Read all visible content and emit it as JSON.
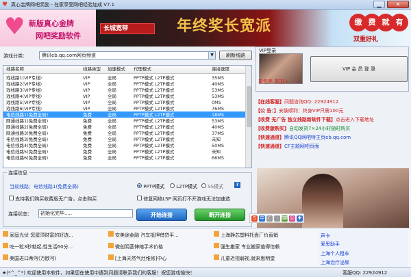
{
  "window": {
    "title": "真心金牌网吧奖励 - 在家享受网吧经验加成 V7.1",
    "minimize": "▁",
    "maximize": "□",
    "close": "✕"
  },
  "banner": {
    "left_line1": "新版真心金牌",
    "left_line2": "网吧奖励软件",
    "isp_logo": "长城宽带",
    "slogan": "年终奖长宽派",
    "promo_circles": [
      "缴",
      "费",
      "就",
      "有"
    ],
    "promo_sub": "双重好礼"
  },
  "game_category": {
    "label": "游戏分类：",
    "selected": "腾讯eb.qq.com网页频道",
    "refresh_button": "刷新线路"
  },
  "table": {
    "headers": [
      "线路名称",
      "线路类型",
      "加速模式",
      "代理模式",
      "连接速度"
    ],
    "rows": [
      [
        "戏线路1(VIP专线)",
        "VIP",
        "全局",
        "PPTP模式 L2TP模式",
        "35MS"
      ],
      [
        "戏线路2(VIP专线)",
        "VIP",
        "全局",
        "PPTP模式 L2TP模式",
        "40MS"
      ],
      [
        "戏线路3(VIP专线)",
        "VIP",
        "全局",
        "PPTP模式 L2TP模式",
        "53MS"
      ],
      [
        "戏线路4(VIP专线)",
        "VIP",
        "全局",
        "PPTP模式 L2TP模式",
        "53MS"
      ],
      [
        "戏线路5(VIP专线)",
        "VIP",
        "全局",
        "PPTP模式 L2TP模式",
        "0MS"
      ],
      [
        "戏线路6(VIP专线)",
        "VIP",
        "全局",
        "PPTP模式 L2TP模式",
        "76MS"
      ],
      [
        "电信线路1(免费全局)",
        "免费",
        "全局",
        "PPTP模式 L2TP模式",
        "18MS"
      ],
      [
        "网通线路1(免费全局)",
        "免费",
        "全局",
        "PPTP模式 L2TP模式",
        "53MS"
      ],
      [
        "网通线路2(免费全局)",
        "免费",
        "全局",
        "PPTP模式 L2TP模式",
        "40MS"
      ],
      [
        "网通线路3(免费全局)",
        "免费",
        "全局",
        "PPTP模式 L2TP模式",
        "37MS"
      ],
      [
        "电信线路3(免费全局)",
        "免费",
        "全局",
        "PPTP模式 L2TP模式",
        "未知"
      ],
      [
        "电信线路4(免费全局)",
        "免费",
        "全局",
        "PPTP模式 L2TP模式",
        "50MS"
      ],
      [
        "电信线路5(免费全局)",
        "免费",
        "全局",
        "PPTP模式 L2TP模式",
        "未知"
      ],
      [
        "电信线路6(免费全局)",
        "免费",
        "全局",
        "PPTP模式 L2TP模式",
        "66MS"
      ]
    ],
    "selected_row": 6
  },
  "connection": {
    "group_title": "连接信息",
    "current_label": "当前线路：",
    "current_value": "电信线路1(免费全局)",
    "mode_pptp": "PPTP模式",
    "mode_l2tp": "L2TP模式",
    "mode_ss": "SS模式",
    "help": "?",
    "support_checkbox": "支持我们购买收费版无广告，点击购买",
    "fix_checkbox": "修复网络LSP 网页打不开游戏无法加速选",
    "status_label": "连接状态：",
    "status_value": "初始化完毕.....",
    "start_button": "开始连接",
    "disconnect_button": "断开连接"
  },
  "vip": {
    "title": "VIP登录",
    "caption_left": "来包养",
    "caption_right": "来加入",
    "login_button": "VIP 会 员 登 录"
  },
  "news": [
    {
      "k": "【在线客服】",
      "v": "问题咨询QQ: 22924912",
      "color": "red"
    },
    {
      "k": "【公  告：】",
      "v": "安装顺利：终身VIP只需100元",
      "color": "red"
    },
    {
      "k": "【收费  无广告  独立线路新软件下载】",
      "v": "点击进入下载地址",
      "color": "red"
    },
    {
      "k": "【收费版购买】",
      "v": "自动发货7×24小时随时购买",
      "color": "green"
    },
    {
      "k": "【快速通道】",
      "v": "腾讯QQ网吧特主页eb.qq.com",
      "color": "blue"
    },
    {
      "k": "【快速通道】",
      "v": "CF主题网吧页面",
      "color": "blue"
    }
  ],
  "bottom_ads": {
    "col1": [
      "家庭光伏 您屋顶财富的好选...",
      "吃一粒3秒勃起,性生活60分...",
      "美国进口蒂泻(万欧可)"
    ],
    "col2": [
      "安美途金融 汽车抵押借贷平...",
      "微创阴茎伸缩手术价格",
      "[上海天然气灶维修]中心"
    ],
    "col3": [
      "上海静芯塑料托盘厂价直销",
      "强生搬家 专业搬家值得信赖",
      "儿童近视弱视,就来思明堂"
    ],
    "side": [
      "声卡",
      "爱思助手",
      "上海个人租车",
      "上海治疗泌尿"
    ]
  },
  "statusbar": {
    "left": "★(*^_^*) 欢迎使用本软件，如果您在使用中遇到问题请联系我们的客服！祝您游戏愉快！",
    "right": "客服QQ: 22924912"
  }
}
